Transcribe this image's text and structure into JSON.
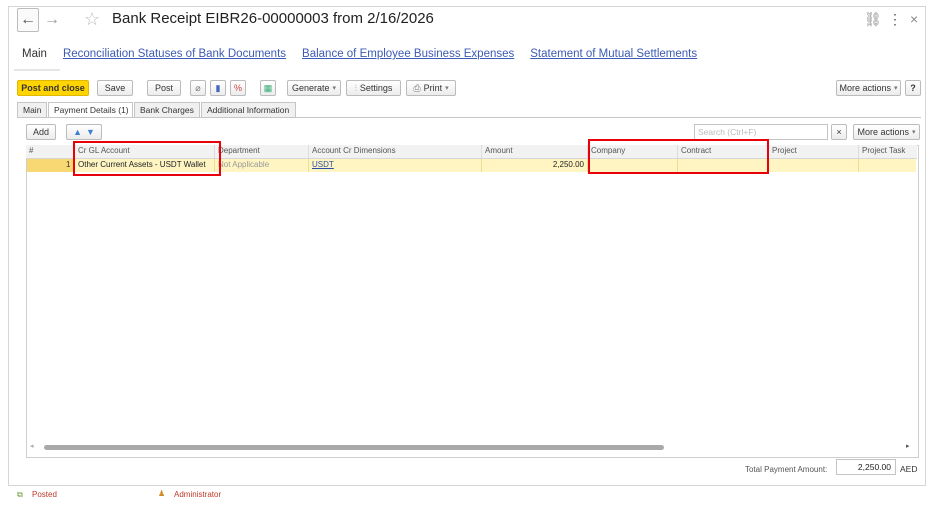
{
  "window": {
    "title": "Bank Receipt EIBR26-00000003 from 2/16/2026",
    "back_icon": "←",
    "forward_icon": "→",
    "star_icon": "☆",
    "link_icon": "⛓",
    "more_icon": "⋮",
    "close_icon": "×"
  },
  "sections": {
    "active": "Main",
    "links": [
      "Reconciliation Statuses of Bank Documents",
      "Balance of Employee Business Expenses",
      "Statement of Mutual Settlements"
    ]
  },
  "toolbar": {
    "post_close": "Post and close",
    "save": "Save",
    "post": "Post",
    "generate": "Generate",
    "settings": "Settings",
    "print": "Print",
    "more_actions": "More actions",
    "help": "?"
  },
  "tabs": [
    "Main",
    "Payment Details (1)",
    "Bank Charges",
    "Additional Information"
  ],
  "grid_toolbar": {
    "add": "Add",
    "search_placeholder": "Search (Ctrl+F)",
    "clear": "×",
    "more_actions": "More actions"
  },
  "table": {
    "columns": [
      "#",
      "Cr GL Account",
      "Department",
      "Account Cr Dimensions",
      "Amount",
      "Company",
      "Contract",
      "Project",
      "Project Task"
    ],
    "rows": [
      [
        "1",
        "Other Current Assets - USDT Wallet",
        "Not Applicable",
        "USDT",
        "2,250.00",
        "",
        "",
        "",
        ""
      ]
    ]
  },
  "totals": {
    "label": "Total Payment Amount:",
    "value": "2,250.00",
    "currency": "AED"
  },
  "status": {
    "posted": "Posted",
    "user": "Administrator"
  }
}
